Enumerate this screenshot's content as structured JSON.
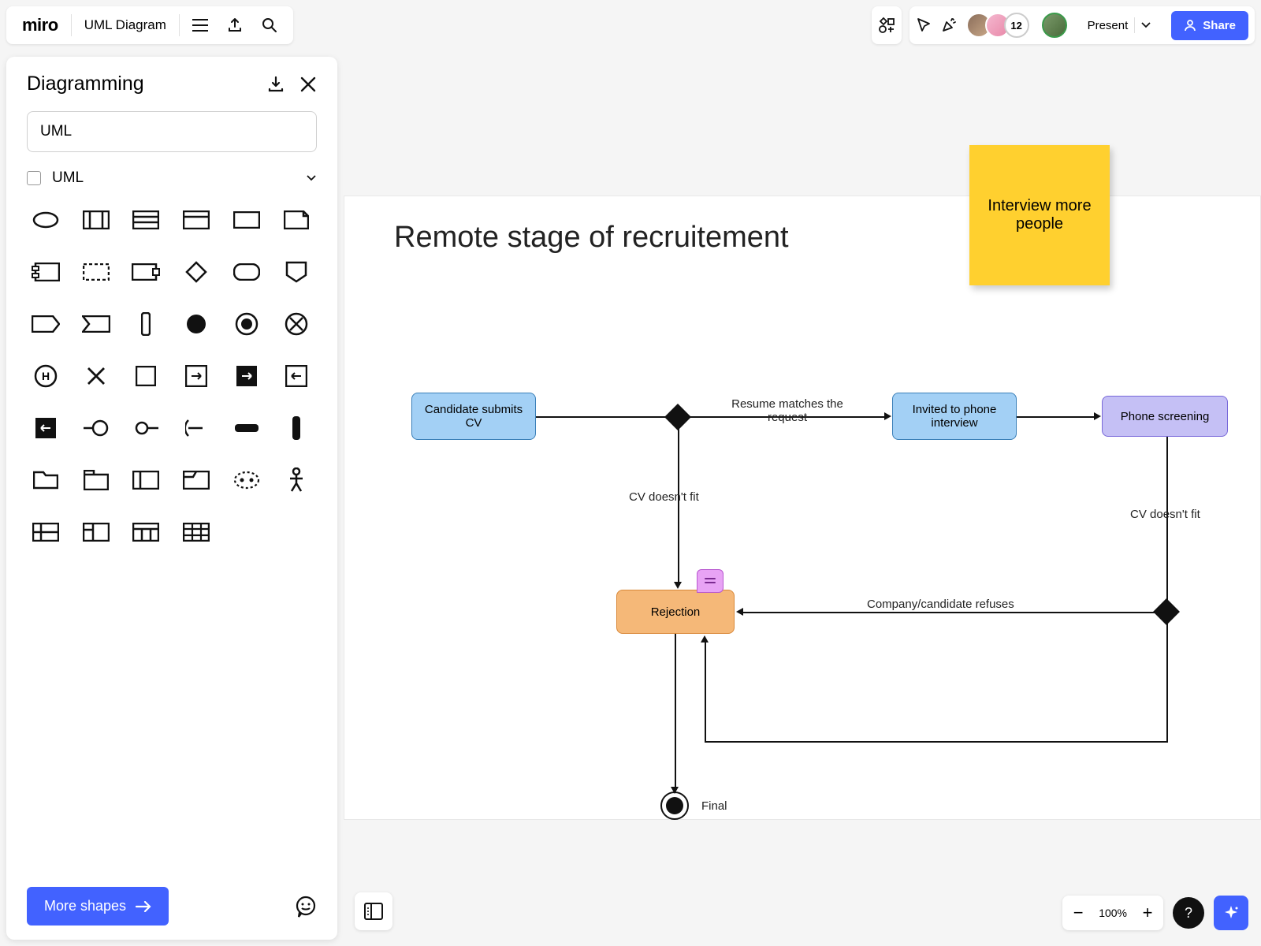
{
  "app": {
    "logo": "miro",
    "board_title": "UML Diagram"
  },
  "topbar": {
    "present_label": "Present",
    "share_label": "Share",
    "avatar_overflow": "12"
  },
  "panel": {
    "title": "Diagramming",
    "search_value": "UML",
    "category": "UML",
    "more_shapes": "More shapes"
  },
  "canvas": {
    "title": "Remote stage of recruitement",
    "sticky": "Interview more people",
    "nodes": {
      "candidate": "Candidate submits CV",
      "invited": "Invited to phone interview",
      "screening": "Phone screening",
      "rejection": "Rejection",
      "final": "Final"
    },
    "edges": {
      "resume_matches": "Resume matches the request",
      "cv_nofit_1": "CV doesn't fit",
      "cv_nofit_2": "CV doesn't fit",
      "company_refuses": "Company/candidate refuses"
    }
  },
  "bottom": {
    "zoom": "100%"
  }
}
